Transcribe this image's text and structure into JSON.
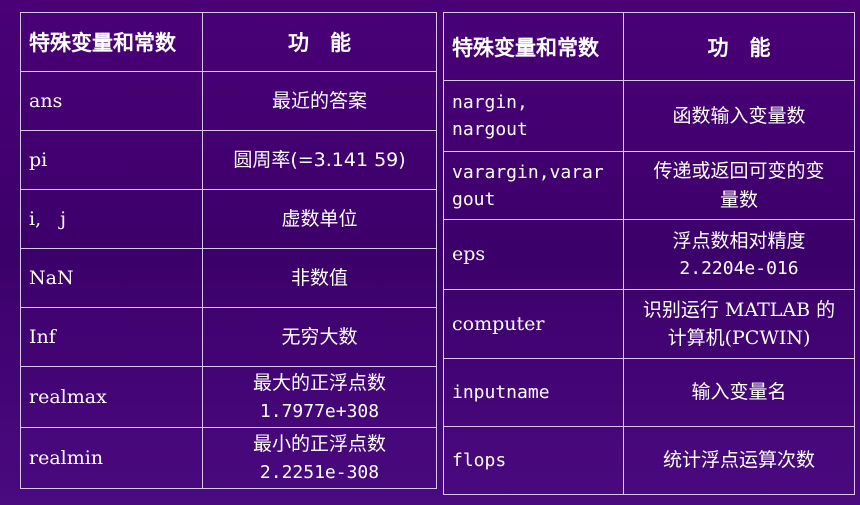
{
  "left_table": {
    "headers": [
      "特殊变量和常数",
      "功　能"
    ],
    "rows": [
      {
        "name": "ans",
        "desc": "最近的答案",
        "desc2": ""
      },
      {
        "name": "pi",
        "desc": "圆周率(=3.141 59)",
        "desc2": ""
      },
      {
        "name": "i,　j",
        "desc": "虚数单位",
        "desc2": ""
      },
      {
        "name": "NaN",
        "desc": "非数值",
        "desc2": ""
      },
      {
        "name": "Inf",
        "desc": "无穷大数",
        "desc2": ""
      },
      {
        "name": "realmax",
        "desc": "最大的正浮点数",
        "desc2": "1.7977e+308"
      },
      {
        "name": "realmin",
        "desc": "最小的正浮点数",
        "desc2": "2.2251e-308"
      }
    ]
  },
  "right_table": {
    "headers": [
      "特殊变量和常数",
      "功　能"
    ],
    "rows": [
      {
        "name": "nargin,",
        "name2": "nargout",
        "desc": "函数输入变量数",
        "desc2": ""
      },
      {
        "name": "varargin,varar",
        "name2": "gout",
        "desc": "传递或返回可变的变",
        "desc2": "量数"
      },
      {
        "name": "eps",
        "name2": "",
        "desc": "浮点数相对精度",
        "desc2": "2.2204e-016"
      },
      {
        "name": "computer",
        "name2": "",
        "desc": "识别运行 MATLAB 的",
        "desc2": "计算机(PCWIN)"
      },
      {
        "name": "inputname",
        "name2": "",
        "desc": "输入变量名",
        "desc2": ""
      },
      {
        "name": "flops",
        "name2": "",
        "desc": "统计浮点运算次数",
        "desc2": ""
      }
    ]
  }
}
